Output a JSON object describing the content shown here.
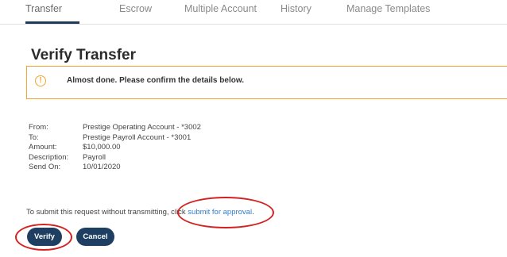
{
  "tabs": [
    {
      "label": "Transfer",
      "active": true
    },
    {
      "label": "Escrow",
      "active": false
    },
    {
      "label": "Multiple Account",
      "active": false
    },
    {
      "label": "History",
      "active": false
    },
    {
      "label": "Manage Templates",
      "active": false
    }
  ],
  "page_title": "Verify Transfer",
  "alert": {
    "icon": "exclamation-circle-icon",
    "glyph": "!",
    "message": "Almost done. Please confirm the details below."
  },
  "details": [
    {
      "label": "From:",
      "value": "Prestige Operating Account - *3002"
    },
    {
      "label": "To:",
      "value": "Prestige Payroll Account - *3001"
    },
    {
      "label": "Amount:",
      "value": "$10,000.00"
    },
    {
      "label": "Description:",
      "value": "Payroll"
    },
    {
      "label": "Send On:",
      "value": "10/01/2020"
    }
  ],
  "submit_note": {
    "prefix": "To submit this request without transmitting, click ",
    "link": "submit for approval",
    "suffix": "."
  },
  "buttons": {
    "verify": "Verify",
    "cancel": "Cancel"
  },
  "colors": {
    "accent_navy": "#1e3f61",
    "warning_orange": "#f0a830",
    "link_blue": "#2f7fd0",
    "annotation_red": "#d6201f"
  }
}
